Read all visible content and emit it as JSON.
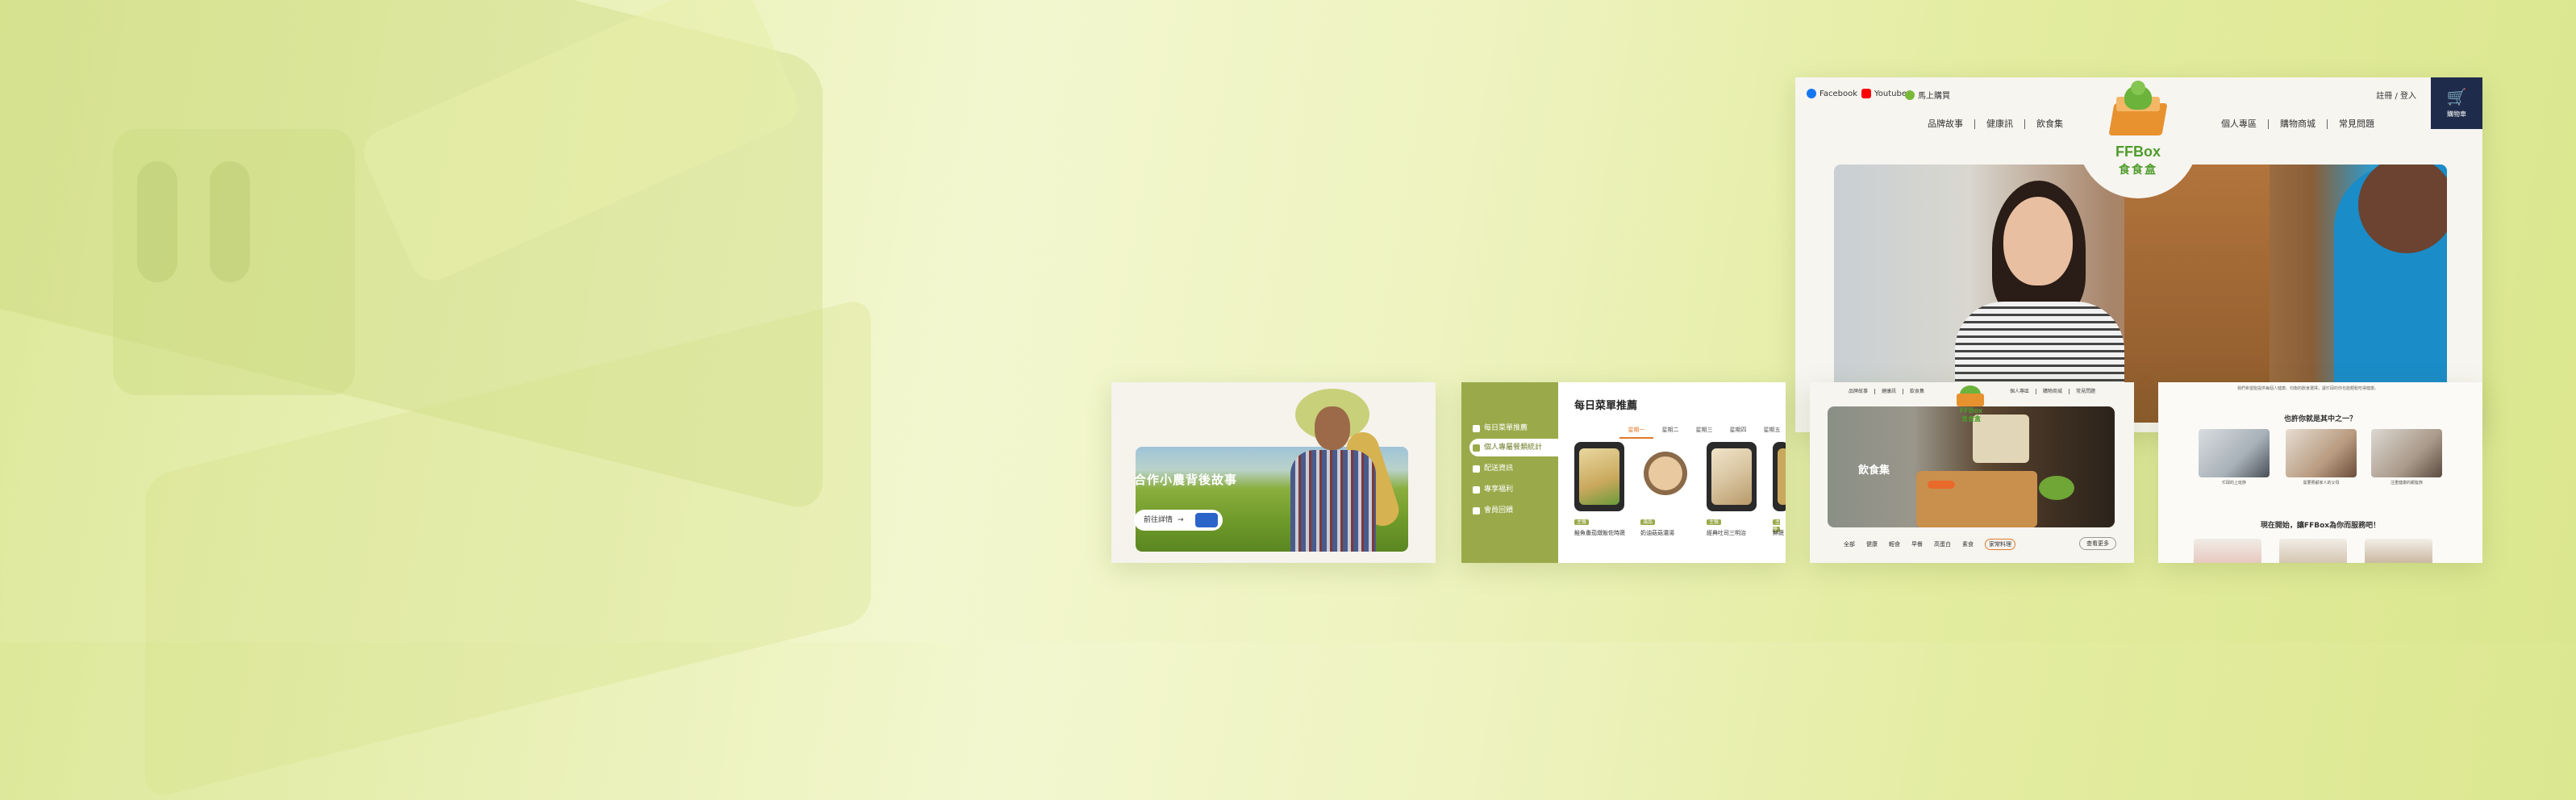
{
  "site": {
    "social": [
      "Facebook",
      "Youtube",
      "馬上購買"
    ],
    "login": "註冊 / 登入",
    "cart_label": "購物車",
    "nav_left": [
      "品牌故事",
      "健康訊",
      "飲食集"
    ],
    "nav_right": [
      "個人專區",
      "購物商城",
      "常見問題"
    ],
    "logo_en": "FFBox",
    "logo_zh": "食食盒"
  },
  "farmer_card": {
    "title": "合作小農背後故事",
    "button": "前往詳情"
  },
  "menu_card": {
    "sidebar": [
      "每日菜單推薦",
      "個人專屬餐類統計",
      "配送資訊",
      "專享福利",
      "會員回饋"
    ],
    "active_index": 1,
    "title": "每日菜單推薦",
    "days": [
      "星期一",
      "星期二",
      "星期三",
      "星期四",
      "星期五"
    ],
    "active_day": 0,
    "dishes": [
      {
        "tag": "主餐",
        "name": "鮭魚番茄燉飯佐時蔬"
      },
      {
        "tag": "湯品",
        "name": "奶油菇菇濃湯"
      },
      {
        "tag": "主餐",
        "name": "經典吐司三明治"
      },
      {
        "tag": "主餐",
        "name": "鮮蔬"
      }
    ],
    "colors": {
      "accent": "#9aaa4a",
      "orange": "#e07a2a"
    }
  },
  "collection_card": {
    "nav_left": [
      "品牌故事",
      "健康訊",
      "飲食集"
    ],
    "nav_right": [
      "個人專區",
      "購物商城",
      "常見問題"
    ],
    "logo_en": "FFBox",
    "logo_zh": "食食盒",
    "title": "飲食集",
    "chips": [
      "全部",
      "健康",
      "輕食",
      "早餐",
      "高蛋白",
      "素食",
      "家常料理"
    ],
    "active_chip": 6,
    "more": "查看更多"
  },
  "about_card": {
    "desc": "我們希望能提供每個人健康、均衡的飲食選擇，讓忙碌的你也能輕鬆吃得健康。",
    "question": "也許你就是其中之一？",
    "photos": [
      "忙碌的上班族",
      "需要照顧家人的父母",
      "注重健康的銀髮族"
    ],
    "cta": "現在開始，讓FFBox為你而服務吧！"
  }
}
